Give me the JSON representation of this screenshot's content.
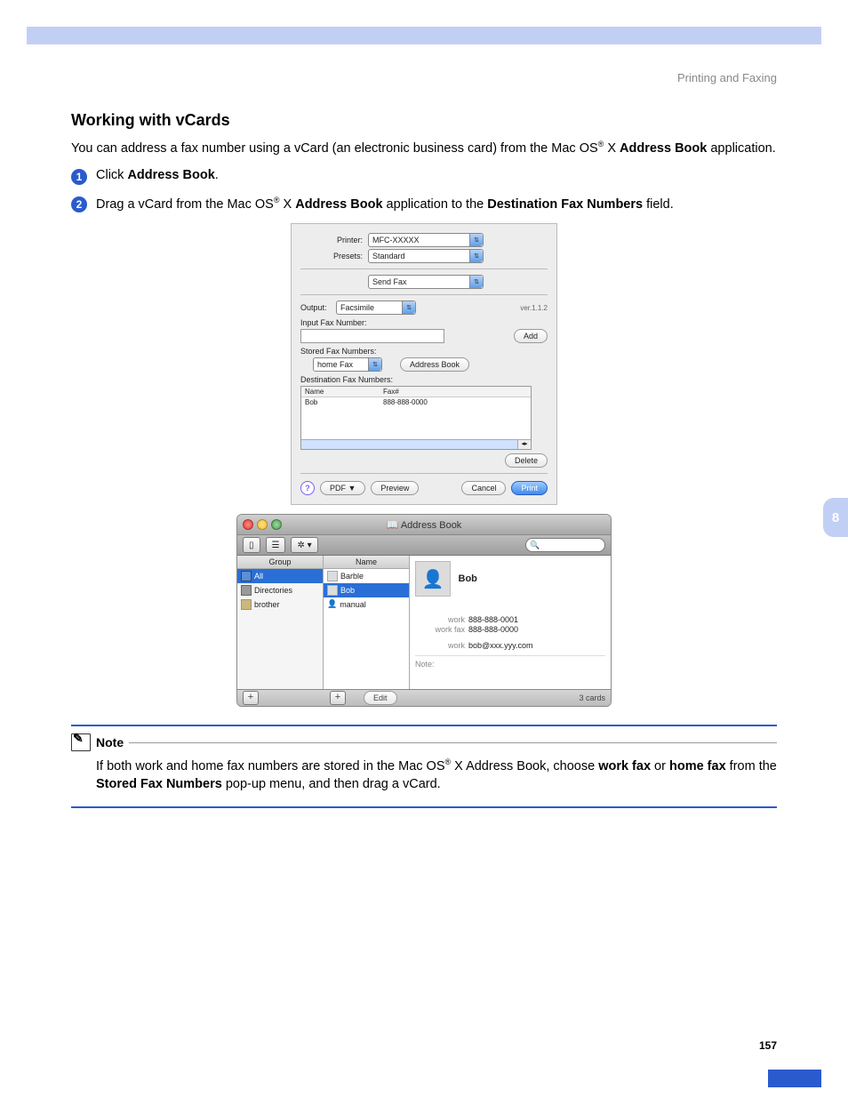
{
  "header": {
    "section": "Printing and Faxing"
  },
  "tab": {
    "num": "8"
  },
  "title": "Working with vCards",
  "intro": {
    "pre": "You can address a fax number using a vCard (an electronic business card) from the Mac OS",
    "reg": "®",
    "post": " X ",
    "bold": "Address Book",
    "tail": " application."
  },
  "steps": {
    "s1": {
      "num": "1",
      "pre": "Click ",
      "bold": "Address Book",
      "post": "."
    },
    "s2": {
      "num": "2",
      "t1": "Drag a vCard from the Mac OS",
      "reg": "®",
      "t2": " X ",
      "b1": "Address Book",
      "t3": " application to the ",
      "b2": "Destination Fax Numbers",
      "t4": " field."
    }
  },
  "printDialog": {
    "printerLabel": "Printer:",
    "printerValue": "MFC-XXXXX",
    "presetsLabel": "Presets:",
    "presetsValue": "Standard",
    "paneValue": "Send Fax",
    "outputLabel": "Output:",
    "outputValue": "Facsimile",
    "version": "ver.1.1.2",
    "inputLabel": "Input Fax Number:",
    "addBtn": "Add",
    "storedLabel": "Stored Fax Numbers:",
    "storedSelect": "home Fax",
    "abBtn": "Address Book",
    "destLabel": "Destination Fax Numbers:",
    "colName": "Name",
    "colFax": "Fax#",
    "rowName": "Bob",
    "rowFax": "888-888-0000",
    "deleteBtn": "Delete",
    "helpBtn": "?",
    "pdfBtn": "PDF ▼",
    "previewBtn": "Preview",
    "cancelBtn": "Cancel",
    "printBtn": "Print"
  },
  "addressBook": {
    "title": "Address Book",
    "gear": "✲ ▾",
    "searchIcon": "🔍",
    "groupHdr": "Group",
    "nameHdr": "Name",
    "groups": {
      "g1": "All",
      "g2": "Directories",
      "g3": "brother"
    },
    "names": {
      "n1": "Barble",
      "n2": "Bob",
      "n3": "manual"
    },
    "detailName": "Bob",
    "fields": {
      "workLbl": "work",
      "workVal": "888-888-0001",
      "faxLbl": "work fax",
      "faxVal": "888-888-0000",
      "emailLbl": "work",
      "emailVal": "bob@xxx.yyy.com"
    },
    "noteLbl": "Note:",
    "plus": "+",
    "editBtn": "Edit",
    "cardCount": "3 cards"
  },
  "note": {
    "label": "Note",
    "t1": "If both work and home fax numbers are stored in the Mac OS",
    "reg": "®",
    "t2": " X Address Book, choose ",
    "b1": "work fax",
    "t3": " or ",
    "b2": "home fax",
    "t4": " from the ",
    "b3": "Stored Fax Numbers",
    "t5": " pop-up menu, and then drag a vCard."
  },
  "pageNum": "157"
}
